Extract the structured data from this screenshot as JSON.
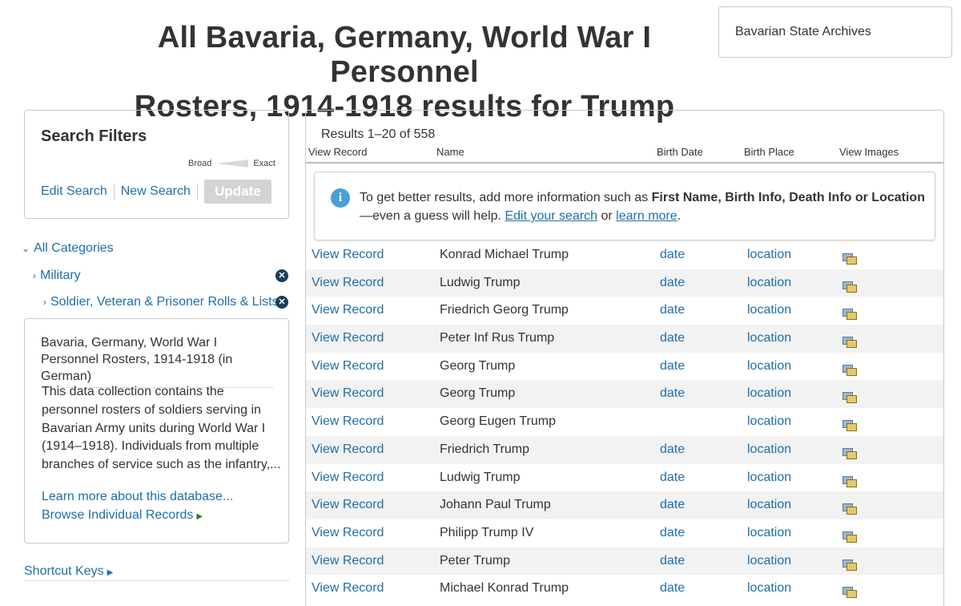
{
  "header": {
    "title_line1": "All Bavaria, Germany, World War I Personnel",
    "title_line2": "Rosters, 1914-1918 results for Trump",
    "collection_box": "Bavarian State Archives"
  },
  "filters": {
    "title": "Search Filters",
    "slider_broad": "Broad",
    "slider_exact": "Exact",
    "edit_search": "Edit Search",
    "new_search": "New Search",
    "update": "Update"
  },
  "categories": {
    "all": "All Categories",
    "military": "Military",
    "soldier": "Soldier, Veteran & Prisoner Rolls & Lists"
  },
  "description": {
    "title": "Bavaria, Germany, World War I Personnel Rosters, 1914-1918 (in German)",
    "text": "This data collection contains the personnel rosters of soldiers serving in Bavarian Army units during World War I (1914–1918). Individuals from multiple branches of service such as the infantry,...",
    "learn_more": "Learn more about this database...",
    "browse": "Browse Individual Records"
  },
  "shortcut_keys": "Shortcut Keys",
  "results": {
    "count": "Results 1–20 of 558",
    "columns": {
      "view_record": "View Record",
      "name": "Name",
      "birth_date": "Birth Date",
      "birth_place": "Birth Place",
      "view_images": "View Images"
    },
    "tip": {
      "prefix": "To get better results, add more information such as ",
      "bold": "First Name, Birth Info, Death Info or Location",
      "middle": "—even a guess will help. ",
      "edit_link": "Edit your search",
      "or": " or ",
      "learn_link": "learn more",
      "suffix": "."
    },
    "rows": [
      {
        "view": "View Record",
        "name": "Konrad Michael Trump",
        "date": "date",
        "location": "location"
      },
      {
        "view": "View Record",
        "name": "Ludwig Trump",
        "date": "date",
        "location": "location"
      },
      {
        "view": "View Record",
        "name": "Friedrich Georg Trump",
        "date": "date",
        "location": "location"
      },
      {
        "view": "View Record",
        "name": "Peter Inf Rus Trump",
        "date": "date",
        "location": "location"
      },
      {
        "view": "View Record",
        "name": "Georg Trump",
        "date": "date",
        "location": "location"
      },
      {
        "view": "View Record",
        "name": "Georg Trump",
        "date": "date",
        "location": "location"
      },
      {
        "view": "View Record",
        "name": "Georg Eugen Trump",
        "date": "",
        "location": "location"
      },
      {
        "view": "View Record",
        "name": "Friedrich Trump",
        "date": "date",
        "location": "location"
      },
      {
        "view": "View Record",
        "name": "Ludwig Trump",
        "date": "date",
        "location": "location"
      },
      {
        "view": "View Record",
        "name": "Johann Paul Trump",
        "date": "date",
        "location": "location"
      },
      {
        "view": "View Record",
        "name": "Philipp Trump IV",
        "date": "date",
        "location": "location"
      },
      {
        "view": "View Record",
        "name": "Peter Trump",
        "date": "date",
        "location": "location"
      },
      {
        "view": "View Record",
        "name": "Michael Konrad Trump",
        "date": "date",
        "location": "location"
      }
    ]
  },
  "colors": {
    "link": "#1f6ea8",
    "remove_icon": "#1b3d5c",
    "info_icon": "#4a9fd8",
    "row_alt": "#f2f2f2"
  }
}
